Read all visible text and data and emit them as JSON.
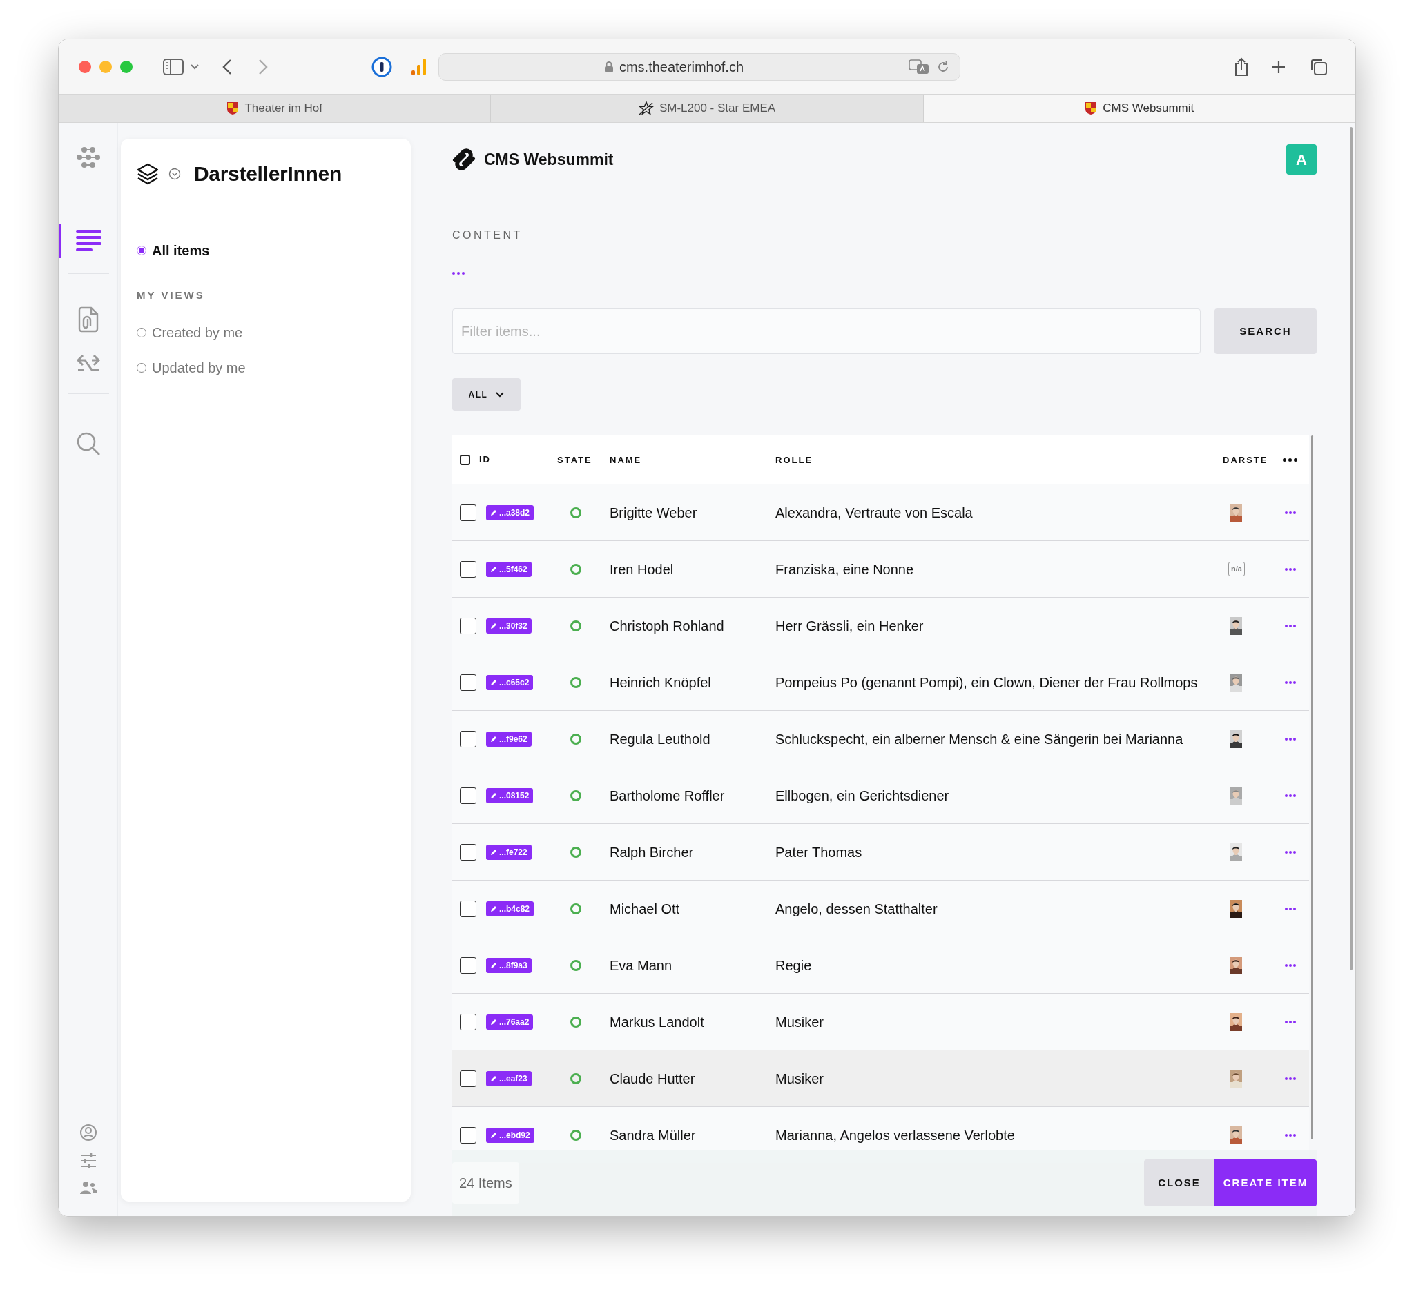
{
  "browser": {
    "address": "cms.theaterimhof.ch",
    "tabs": [
      {
        "title": "Theater im Hof",
        "selected": false
      },
      {
        "title": "SM-L200 - Star EMEA",
        "selected": false
      },
      {
        "title": "CMS Websummit",
        "selected": true
      }
    ]
  },
  "rail": {
    "items": [
      {
        "kind": "nodes",
        "selected": false
      },
      {
        "kind": "list",
        "selected": true
      },
      {
        "kind": "file",
        "selected": false
      },
      {
        "kind": "swap",
        "selected": false
      },
      {
        "kind": "search",
        "selected": false
      },
      {
        "kind": "user",
        "selected": false
      },
      {
        "kind": "sliders",
        "selected": false
      },
      {
        "kind": "users",
        "selected": false
      }
    ]
  },
  "sidebar": {
    "title": "DarstellerInnen",
    "views": [
      {
        "label": "All items",
        "selected": true
      }
    ],
    "section": "MY VIEWS",
    "my_views": [
      {
        "label": "Created by me",
        "selected": false
      },
      {
        "label": "Updated by me",
        "selected": false
      }
    ]
  },
  "header": {
    "app_name": "CMS Websummit",
    "avatar": "A"
  },
  "breadcrumb": "CONTENT",
  "filter": {
    "placeholder": "Filter items...",
    "button": "SEARCH"
  },
  "status_filter": "ALL",
  "table": {
    "all_selected": false,
    "columns": [
      "ID",
      "STATE",
      "NAME",
      "ROLLE",
      "DARSTE"
    ],
    "rows": [
      {
        "id": "...a38d2",
        "name": "Brigitte Weber",
        "rolle": "Alexandra, Vertraute von Escala",
        "hovered": false
      },
      {
        "id": "...5f462",
        "name": "Iren Hodel",
        "rolle": "Franziska, eine Nonne",
        "kind": "no-photo",
        "photo_label": "n/a",
        "hovered": false
      },
      {
        "id": "...30f32",
        "name": "Christoph Rohland",
        "rolle": "Herr Grässli, ein Henker",
        "hovered": false
      },
      {
        "id": "...c65c2",
        "name": "Heinrich Knöpfel",
        "rolle": "Pompeius Po (genannt Pompi), ein Clown, Diener der Frau Rollmops",
        "hovered": false
      },
      {
        "id": "...f9e62",
        "name": "Regula Leuthold",
        "rolle": "Schluckspecht, ein alberner Mensch & eine Sängerin bei Marianna",
        "hovered": false
      },
      {
        "id": "...08152",
        "name": "Bartholome Roffler",
        "rolle": "Ellbogen, ein Gerichtsdiener",
        "hovered": false
      },
      {
        "id": "...fe722",
        "name": "Ralph Bircher",
        "rolle": "Pater Thomas",
        "hovered": false
      },
      {
        "id": "...b4c82",
        "name": "Michael Ott",
        "rolle": "Angelo, dessen Statthalter",
        "hovered": false
      },
      {
        "id": "...8f9a3",
        "name": "Eva Mann",
        "rolle": "Regie",
        "hovered": false
      },
      {
        "id": "...76aa2",
        "name": "Markus Landolt",
        "rolle": "Musiker",
        "hovered": false
      },
      {
        "id": "...eaf23",
        "name": "Claude Hutter",
        "rolle": "Musiker",
        "hovered": true
      },
      {
        "id": "...ebd92",
        "name": "Sandra Müller",
        "rolle": "Marianna, Angelos verlassene Verlobte",
        "hovered": false
      }
    ]
  },
  "footer": {
    "count": "24 Items",
    "buttons": [
      {
        "label": "CLOSE",
        "kind": "secondary"
      },
      {
        "label": "CREATE ITEM",
        "kind": "primary"
      }
    ]
  }
}
